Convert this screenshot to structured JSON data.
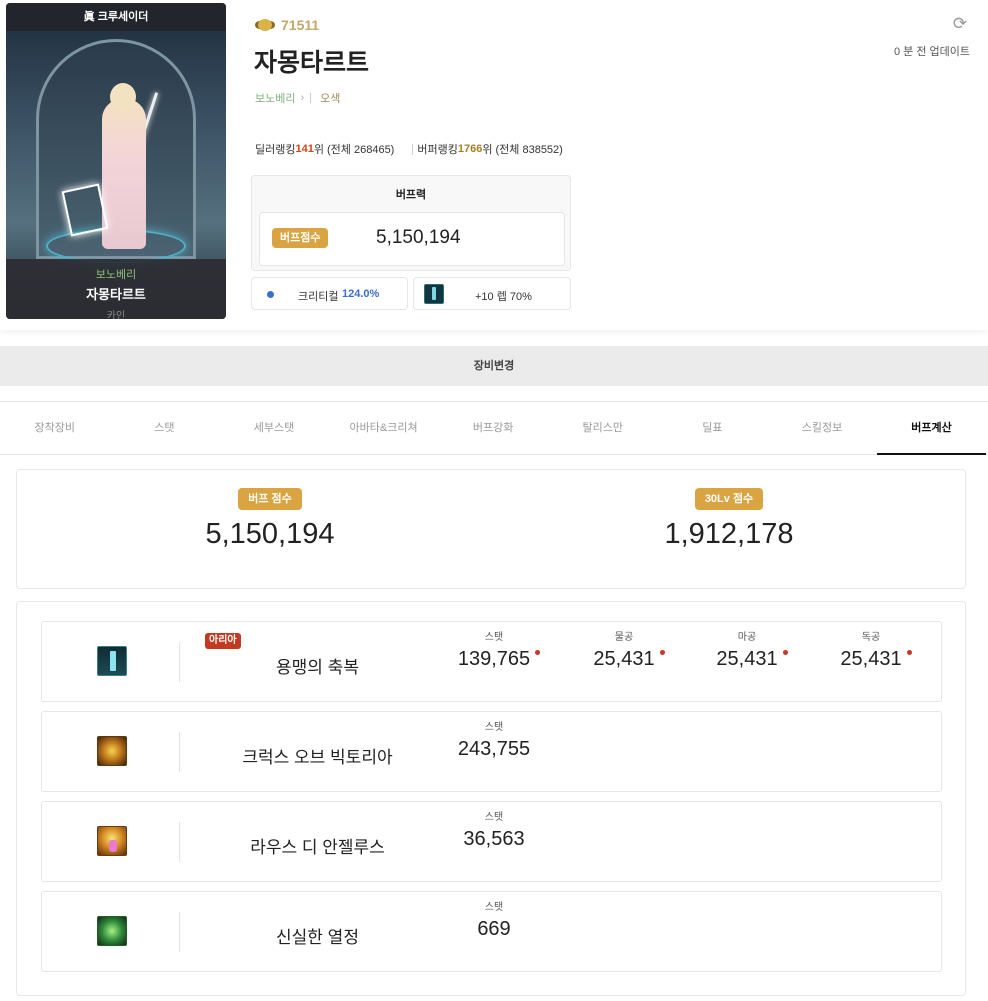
{
  "character": {
    "job_title": "眞 크루세이더",
    "adventure_name": "보노베리",
    "name": "자몽타르트",
    "server": "카인",
    "fame": "71511",
    "guild": "오색",
    "updated": "0 분 전 업데이트"
  },
  "ranking": {
    "dealer_prefix": "딜러랭킹 ",
    "dealer_rank": "141",
    "dealer_suffix": "위 (전체 268465)",
    "buffer_prefix": "버퍼랭킹 ",
    "buffer_rank": "1766",
    "buffer_suffix": "위 (전체 838552)"
  },
  "buff_power": {
    "title": "버프력",
    "badge": "버프점수",
    "value": "5,150,194",
    "crit_label": "크리티컬",
    "crit_value": "124.0%",
    "weapon_label": "+10 렙 70%"
  },
  "equip_change_label": "장비변경",
  "tabs": [
    {
      "label": "장착장비",
      "active": false
    },
    {
      "label": "스탯",
      "active": false
    },
    {
      "label": "세부스탯",
      "active": false
    },
    {
      "label": "아바타&크리쳐",
      "active": false
    },
    {
      "label": "버프강화",
      "active": false
    },
    {
      "label": "탈리스만",
      "active": false
    },
    {
      "label": "딜표",
      "active": false
    },
    {
      "label": "스킬정보",
      "active": false
    },
    {
      "label": "버프계산",
      "active": true
    }
  ],
  "scores": {
    "buff_label": "버프 점수",
    "buff_value": "5,150,194",
    "lv30_label": "30Lv 점수",
    "lv30_value": "1,912,178"
  },
  "buffs": [
    {
      "name": "용맹의 축복",
      "icon": "dragon-blessing-icon",
      "tag": "아리아",
      "stats": [
        {
          "label": "스탯",
          "value": "139,765",
          "dot": true
        },
        {
          "label": "물공",
          "value": "25,431",
          "dot": true
        },
        {
          "label": "마공",
          "value": "25,431",
          "dot": true
        },
        {
          "label": "독공",
          "value": "25,431",
          "dot": true
        }
      ]
    },
    {
      "name": "크럭스 오브 빅토리아",
      "icon": "crux-of-victoria-icon",
      "stats": [
        {
          "label": "스탯",
          "value": "243,755"
        }
      ]
    },
    {
      "name": "라우스 디 안젤루스",
      "icon": "laus-di-angelus-icon",
      "stats": [
        {
          "label": "스탯",
          "value": "36,563"
        }
      ]
    },
    {
      "name": "신실한 열정",
      "icon": "faithful-passion-icon",
      "stats": [
        {
          "label": "스탯",
          "value": "669"
        }
      ]
    }
  ],
  "colors": {
    "accent_gold": "#d9a441",
    "dealer_rank": "#d1451b",
    "buffer_rank": "#a57f24",
    "crit_blue": "#3a6ed3",
    "tag_red": "#c33a22"
  }
}
